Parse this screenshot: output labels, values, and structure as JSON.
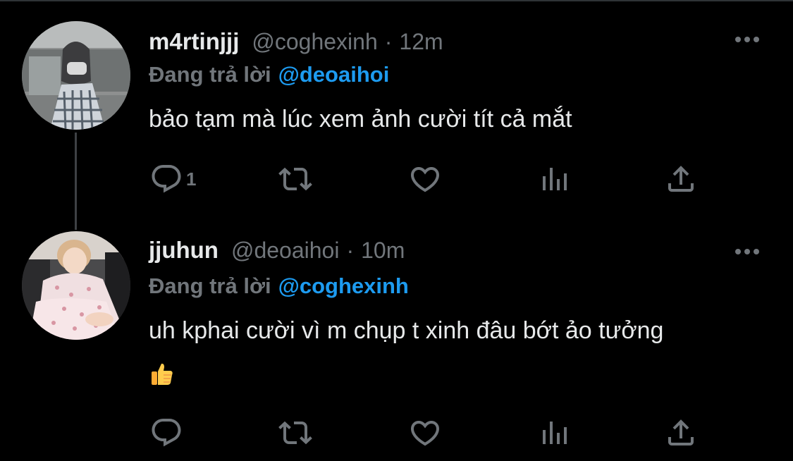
{
  "tweets": [
    {
      "display_name": "m4rtinjjj",
      "handle": "@coghexinh",
      "separator": "·",
      "time": "12m",
      "reply_prefix": "Đang trả lời",
      "reply_to": "@deoaihoi",
      "text": "bảo tạm mà lúc xem ảnh cười tít cả mắt",
      "reply_count": "1"
    },
    {
      "display_name": "jjuhun",
      "handle": "@deoaihoi",
      "separator": "·",
      "time": "10m",
      "reply_prefix": "Đang trả lời",
      "reply_to": "@coghexinh",
      "text": "uh kphai cười vì m chụp t xinh đâu bớt ảo tưởng",
      "emoji": "👍",
      "reply_count": ""
    }
  ],
  "icons": [
    "reply-icon",
    "retweet-icon",
    "like-icon",
    "analytics-icon",
    "share-icon",
    "more-icon"
  ],
  "colors": {
    "background": "#000000",
    "text": "#e7e9ea",
    "secondary": "#71767b",
    "accent": "#1d9bf0"
  }
}
